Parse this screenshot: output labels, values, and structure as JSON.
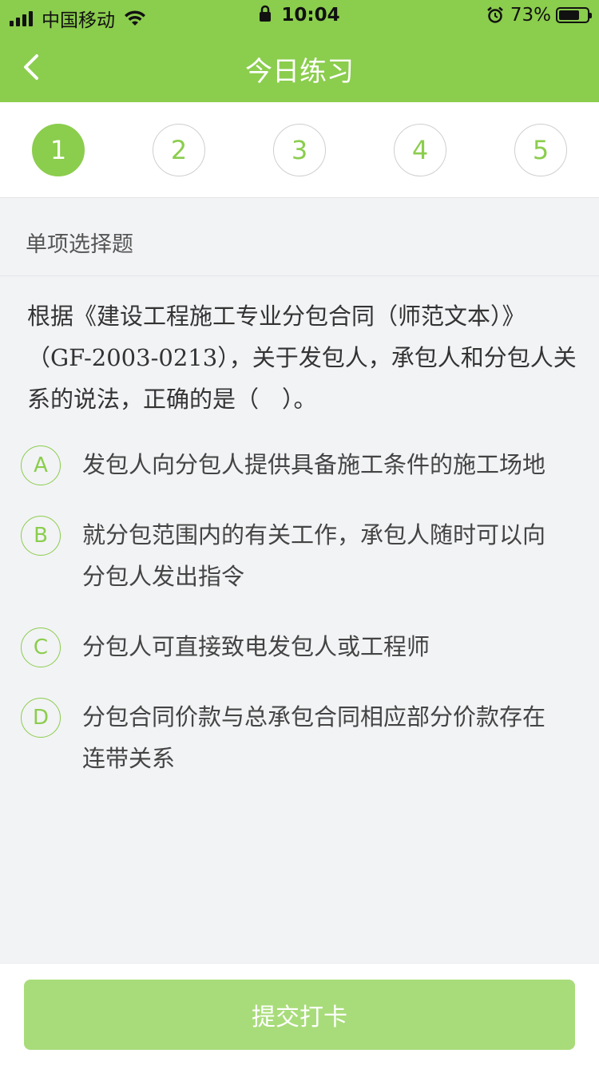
{
  "status_bar": {
    "carrier": "中国移动",
    "time": "10:04",
    "battery_percent": "73%",
    "battery_level": 0.73
  },
  "nav": {
    "title": "今日练习",
    "back_icon": "chevron-left-icon"
  },
  "steps": [
    {
      "label": "1",
      "active": true
    },
    {
      "label": "2",
      "active": false
    },
    {
      "label": "3",
      "active": false
    },
    {
      "label": "4",
      "active": false
    },
    {
      "label": "5",
      "active": false
    }
  ],
  "question": {
    "type": "单项选择题",
    "lines": [
      "根据《建设工程施工专业分包合同（师范文本）》",
      "（GF-2003-0213），关于发包人，承包人和分包人关",
      "系的说法，正确的是（　）。"
    ],
    "options": [
      {
        "key": "A",
        "lines": [
          "发包人向分包人提供具备施工条件的施工场地"
        ]
      },
      {
        "key": "B",
        "lines": [
          "就分包范围内的有关工作，承包人随时可以向",
          "分包人发出指令"
        ]
      },
      {
        "key": "C",
        "lines": [
          "分包人可直接致电发包人或工程师"
        ]
      },
      {
        "key": "D",
        "lines": [
          "分包合同价款与总承包合同相应部分价款存在",
          "连带关系"
        ]
      }
    ]
  },
  "footer": {
    "submit_label": "提交打卡"
  },
  "colors": {
    "brand": "#8bcd4d",
    "submit_disabled": "#a8dc7a"
  }
}
